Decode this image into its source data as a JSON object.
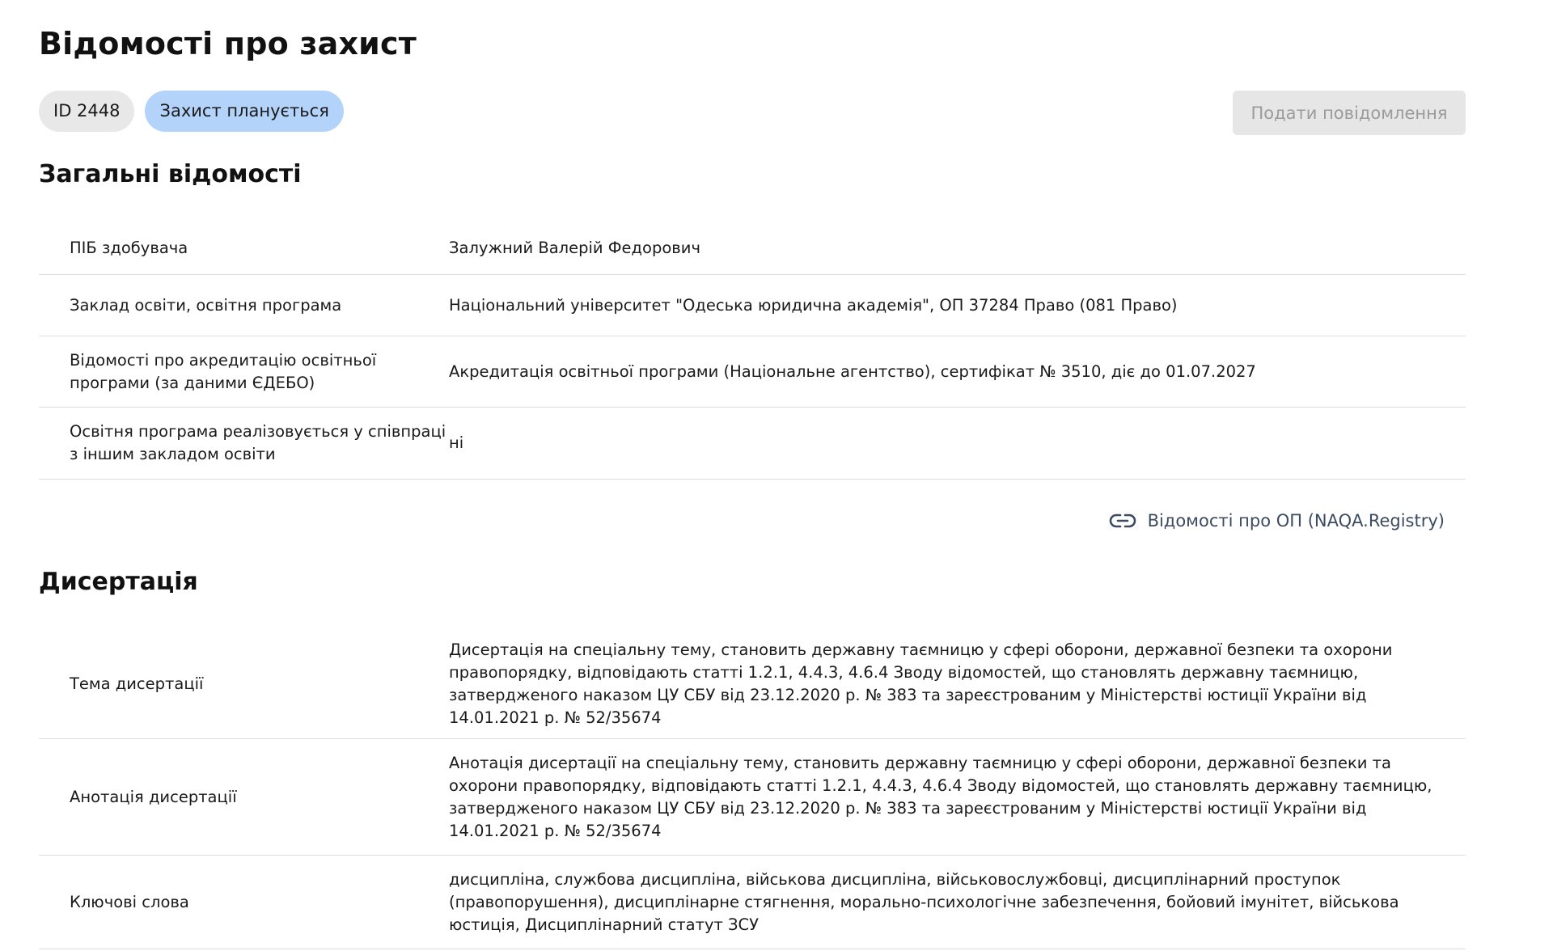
{
  "page": {
    "title": "Відомості про захист"
  },
  "chips": {
    "id": "ID 2448",
    "status": "Захист планується"
  },
  "actions": {
    "submit_label": "Подати повідомлення"
  },
  "general": {
    "title": "Загальні відомості",
    "rows": [
      {
        "label": "ПІБ здобувача",
        "value": "Залужний Валерій Федорович"
      },
      {
        "label": "Заклад освіти, освітня програма",
        "value": "Національний університет \"Одеська юридична академія\", ОП 37284 Право (081 Право)"
      },
      {
        "label": "Відомості про акредитацію освітньої програми (за даними ЄДЕБО)",
        "value": "Акредитація освітньої програми (Національне агентство), сертифікат № 3510, діє до 01.07.2027"
      },
      {
        "label": "Освітня програма реалізовується у співпраці з іншим закладом освіти",
        "value": "ні"
      }
    ],
    "registry_link": {
      "icon": "link-icon",
      "label": "Відомості про ОП (NAQA.Registry)"
    }
  },
  "dissertation": {
    "title": "Дисертація",
    "rows": [
      {
        "label": "Тема дисертації",
        "value": "Дисертація на спеціальну тему, становить державну таємницю у сфері оборони, державної безпеки та охорони правопорядку, відповідають статті 1.2.1, 4.4.3, 4.6.4 Зводу відомостей, що становлять державну таємницю, затвердженого наказом ЦУ СБУ від 23.12.2020 р. № 383 та зареєстрованим у Міністерстві юстиції України від 14.01.2021 р. № 52/35674"
      },
      {
        "label": "Анотація дисертації",
        "value": "Анотація дисертації на спеціальну тему, становить державну таємницю у сфері оборони, державної безпеки та охорони правопорядку, відповідають статті 1.2.1, 4.4.3, 4.6.4 Зводу відомостей, що становлять державну таємницю, затвердженого наказом ЦУ СБУ від 23.12.2020 р. № 383 та зареєстрованим у Міністерстві юстиції України від 14.01.2021 р. № 52/35674"
      },
      {
        "label": "Ключові слова",
        "value": "дисципліна, службова дисципліна, військова дисципліна, військовослужбовці, дисциплінарний проступок (правопорушення), дисциплінарне стягнення, морально-психологічне забезпечення, бойовий імунітет, військова юстиція, Дисциплінарний статут ЗСУ"
      }
    ]
  },
  "colors": {
    "status_chip": "#b3d3fb",
    "id_chip": "#e8e8e8",
    "disabled_button": "#e6e6e6",
    "link": "#3c4b61",
    "divider": "#dcdcdc"
  }
}
